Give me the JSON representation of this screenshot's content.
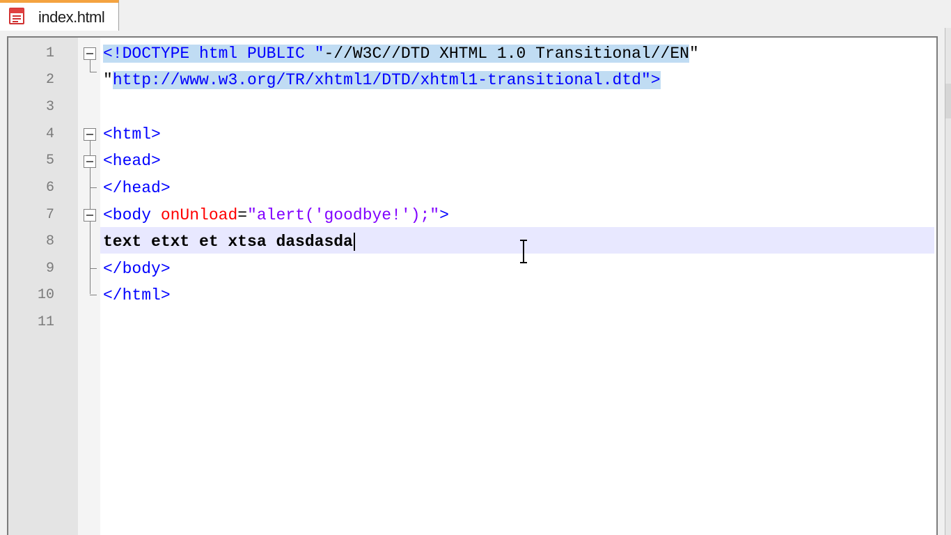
{
  "tabs": [
    {
      "label": "index.html",
      "icon": "html-file-icon",
      "active": true
    }
  ],
  "colors": {
    "tab_accent": "#f4a340",
    "tag": "#0000ff",
    "attribute": "#ff0000",
    "string": "#8000ff",
    "selection": "#c0dcf3",
    "current_line": "#e8e8ff"
  },
  "editor": {
    "line_numbers": [
      "1",
      "2",
      "3",
      "4",
      "5",
      "6",
      "7",
      "8",
      "9",
      "10",
      "11"
    ],
    "current_line": 8,
    "lines": [
      {
        "parts": [
          "<!DOCTYPE html PUBLIC \"",
          "-//W3C//DTD XHTML 1.0 Transitional//EN",
          "\""
        ]
      },
      {
        "parts": [
          "\"",
          "http://www.w3.org/TR/xhtml1/DTD/xhtml1-transitional.dtd",
          "\">"
        ]
      },
      {
        "parts": []
      },
      {
        "parts": [
          "<html>"
        ]
      },
      {
        "parts": [
          "<head>"
        ]
      },
      {
        "parts": [
          "</head>"
        ]
      },
      {
        "parts": [
          "<body ",
          "onUnload",
          "=",
          "\"alert('goodbye!');\"",
          ">"
        ]
      },
      {
        "parts": [
          "text etxt et xtsa dasdasda"
        ]
      },
      {
        "parts": [
          "</body>"
        ]
      },
      {
        "parts": [
          "</html>"
        ]
      },
      {
        "parts": []
      }
    ]
  }
}
